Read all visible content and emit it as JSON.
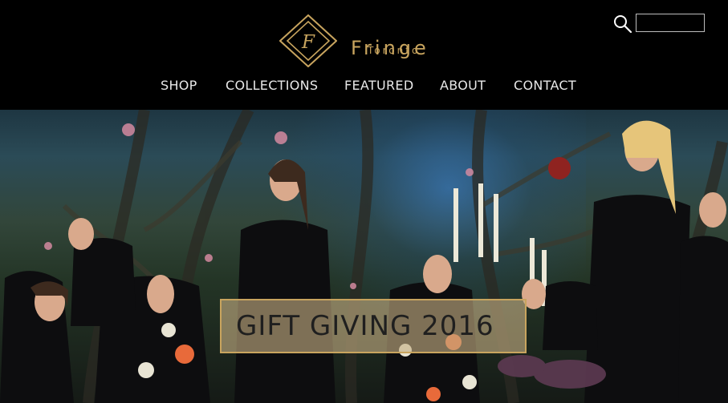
{
  "brand": {
    "name": "Fringe",
    "sub": "Toronto",
    "logo_letter": "F"
  },
  "search": {
    "value": "",
    "placeholder": ""
  },
  "nav": {
    "items": [
      "SHOP",
      "COLLECTIONS",
      "FEATURED",
      "ABOUT",
      "CONTACT"
    ]
  },
  "hero": {
    "banner": "GIFT GIVING 2016"
  },
  "colors": {
    "accent": "#c8a45e",
    "header_bg": "#000000",
    "nav_text": "#e8e8e8"
  },
  "icons": {
    "search": "search-icon",
    "logo": "diamond-logo-icon"
  }
}
